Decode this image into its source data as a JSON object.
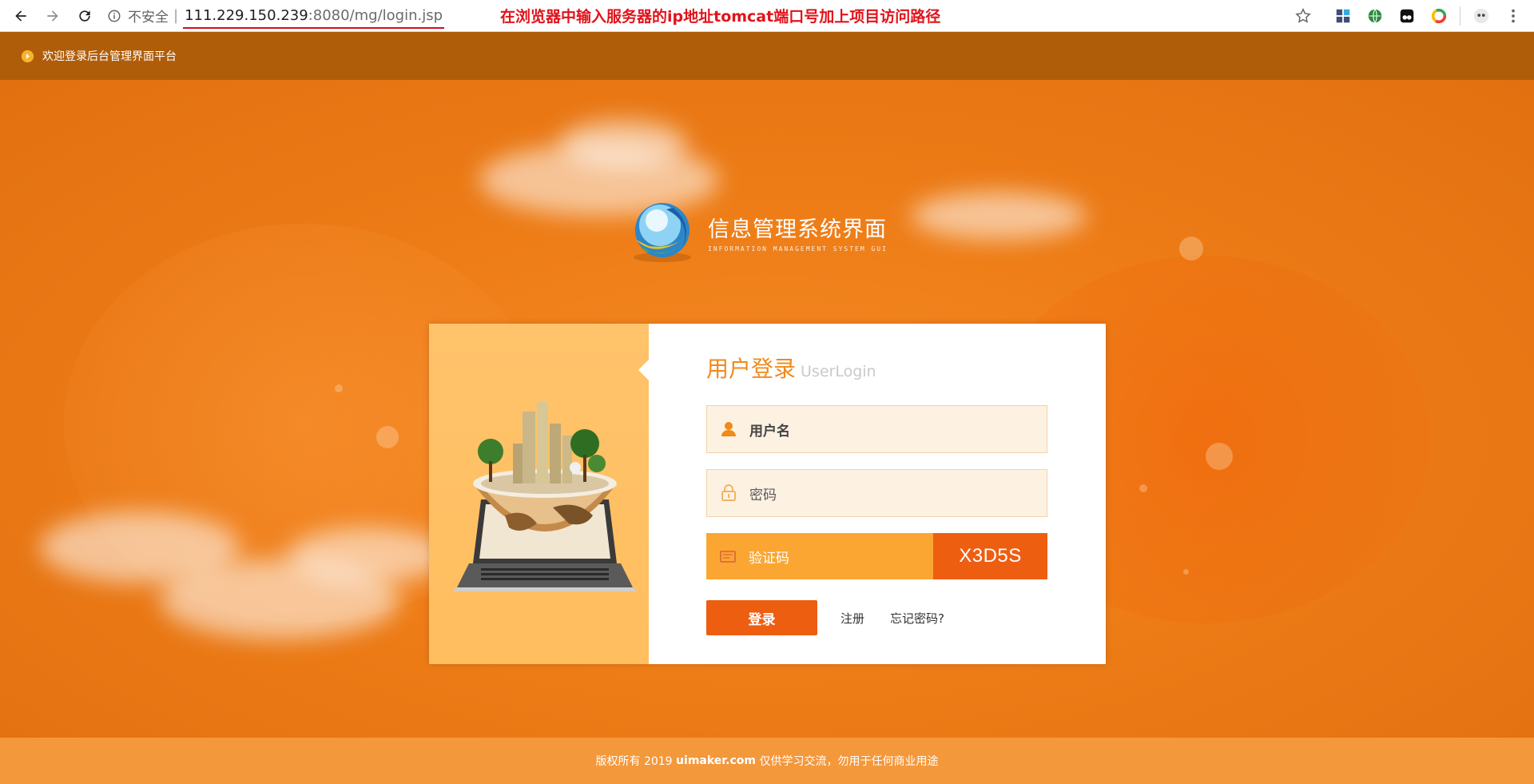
{
  "browser": {
    "security_label": "不安全",
    "separator": "|",
    "url_host": "111.229.150.239",
    "url_path": ":8080/mg/login.jsp",
    "annotation": "在浏览器中输入服务器的ip地址tomcat端口号加上项目访问路径"
  },
  "header": {
    "welcome": "欢迎登录后台管理界面平台"
  },
  "logo": {
    "title": "信息管理系统界面",
    "subtitle": "INFORMATION MANAGEMENT SYSTEM GUI"
  },
  "login": {
    "title_cn": "用户登录",
    "title_en": "UserLogin",
    "username_placeholder": "用户名",
    "password_placeholder": "密码",
    "captcha_placeholder": "验证码",
    "captcha_code": "X3D5S",
    "submit_label": "登录",
    "register_label": "注册",
    "forgot_label": "忘记密码?"
  },
  "footer": {
    "prefix": "版权所有 2019 ",
    "brand": "uimaker.com",
    "suffix": " 仅供学习交流，勿用于任何商业用途"
  },
  "colors": {
    "accent": "#ee5e11",
    "header_bg": "#b05d0a",
    "background": "#ec7a16",
    "annotation": "#e1131b"
  }
}
